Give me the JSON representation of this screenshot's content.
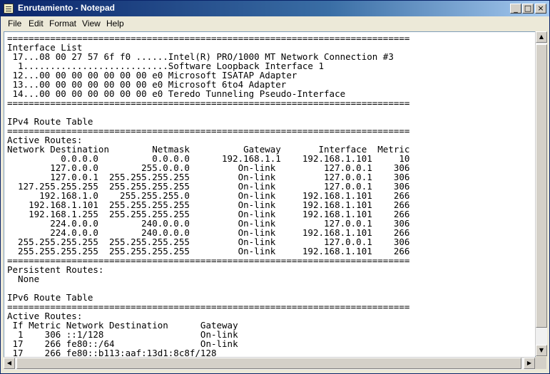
{
  "window": {
    "title": "Enrutamiento - Notepad",
    "minimize_glyph": "_",
    "maximize_glyph": "□",
    "close_glyph": "×",
    "titlebar_color": "#0a246a"
  },
  "menu": [
    "File",
    "Edit",
    "Format",
    "View",
    "Help"
  ],
  "editor": {
    "lines": [
      "===========================================================================",
      "Interface List",
      " 17...08 00 27 57 6f f0 ......Intel(R) PRO/1000 MT Network Connection #3",
      "  1...........................Software Loopback Interface 1",
      " 12...00 00 00 00 00 00 00 e0 Microsoft ISATAP Adapter",
      " 13...00 00 00 00 00 00 00 e0 Microsoft 6to4 Adapter",
      " 14...00 00 00 00 00 00 00 e0 Teredo Tunneling Pseudo-Interface",
      "===========================================================================",
      "",
      "IPv4 Route Table",
      "===========================================================================",
      "Active Routes:",
      "Network Destination        Netmask          Gateway       Interface  Metric",
      "          0.0.0.0          0.0.0.0      192.168.1.1    192.168.1.101     10",
      "        127.0.0.0        255.0.0.0         On-link         127.0.0.1    306",
      "        127.0.0.1  255.255.255.255         On-link         127.0.0.1    306",
      "  127.255.255.255  255.255.255.255         On-link         127.0.0.1    306",
      "      192.168.1.0    255.255.255.0         On-link     192.168.1.101    266",
      "    192.168.1.101  255.255.255.255         On-link     192.168.1.101    266",
      "    192.168.1.255  255.255.255.255         On-link     192.168.1.101    266",
      "        224.0.0.0        240.0.0.0         On-link         127.0.0.1    306",
      "        224.0.0.0        240.0.0.0         On-link     192.168.1.101    266",
      "  255.255.255.255  255.255.255.255         On-link         127.0.0.1    306",
      "  255.255.255.255  255.255.255.255         On-link     192.168.1.101    266",
      "===========================================================================",
      "Persistent Routes:",
      "  None",
      "",
      "IPv6 Route Table",
      "===========================================================================",
      "Active Routes:",
      " If Metric Network Destination      Gateway",
      "  1    306 ::1/128                  On-link",
      " 17    266 fe80::/64                On-link",
      " 17    266 fe80::b113:aaf:13d1:8c8f/128"
    ]
  },
  "scrollbar": {
    "up_glyph": "▲",
    "down_glyph": "▼",
    "left_glyph": "◀",
    "right_glyph": "▶"
  }
}
